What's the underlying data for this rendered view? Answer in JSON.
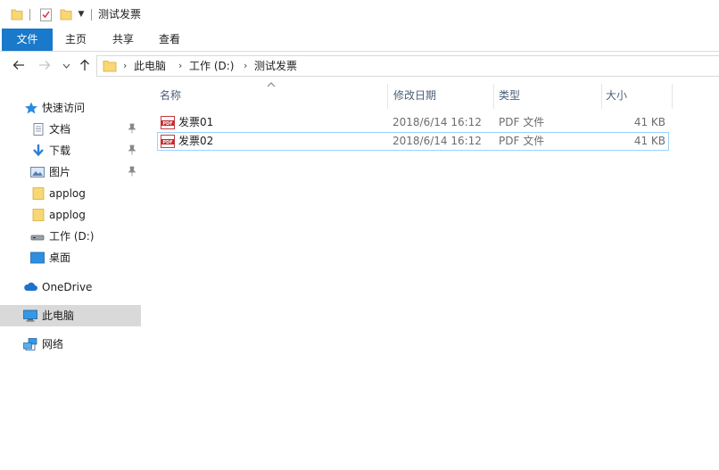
{
  "window": {
    "title": "测试发票",
    "quick_access_toolbar": {
      "icons": [
        "folder-icon",
        "properties-icon",
        "new-folder-icon",
        "customize-dropdown-icon"
      ]
    }
  },
  "ribbon": {
    "tabs": [
      {
        "label": "文件",
        "active": true
      },
      {
        "label": "主页"
      },
      {
        "label": "共享"
      },
      {
        "label": "查看"
      }
    ]
  },
  "address_bar": {
    "breadcrumbs": [
      "此电脑",
      "工作 (D:)",
      "测试发票"
    ]
  },
  "sidebar": {
    "quick_access": {
      "label": "快速访问",
      "items": [
        {
          "label": "文档",
          "icon": "documents-icon",
          "pinned": true
        },
        {
          "label": "下载",
          "icon": "download-icon",
          "pinned": true
        },
        {
          "label": "图片",
          "icon": "pictures-icon",
          "pinned": true
        },
        {
          "label": "applog",
          "icon": "folder-icon"
        },
        {
          "label": "applog",
          "icon": "folder-icon"
        },
        {
          "label": "工作 (D:)",
          "icon": "drive-icon"
        },
        {
          "label": "桌面",
          "icon": "desktop-icon"
        }
      ]
    },
    "onedrive": {
      "label": "OneDrive"
    },
    "this_pc": {
      "label": "此电脑",
      "selected": true
    },
    "network": {
      "label": "网络"
    }
  },
  "file_list": {
    "columns": [
      "名称",
      "修改日期",
      "类型",
      "大小"
    ],
    "sort_column": "名称",
    "rows": [
      {
        "name": "发票01",
        "modified": "2018/6/14 16:12",
        "type": "PDF 文件",
        "size": "41 KB",
        "selected": false
      },
      {
        "name": "发票02",
        "modified": "2018/6/14 16:12",
        "type": "PDF 文件",
        "size": "41 KB",
        "selected": true
      }
    ]
  },
  "colors": {
    "file_tab_bg": "#1979ca",
    "selection_border": "#99d1ff",
    "selected_nav_bg": "#d9d9d9",
    "header_text": "#4c607a",
    "folder_yellow": "#f8d775"
  }
}
